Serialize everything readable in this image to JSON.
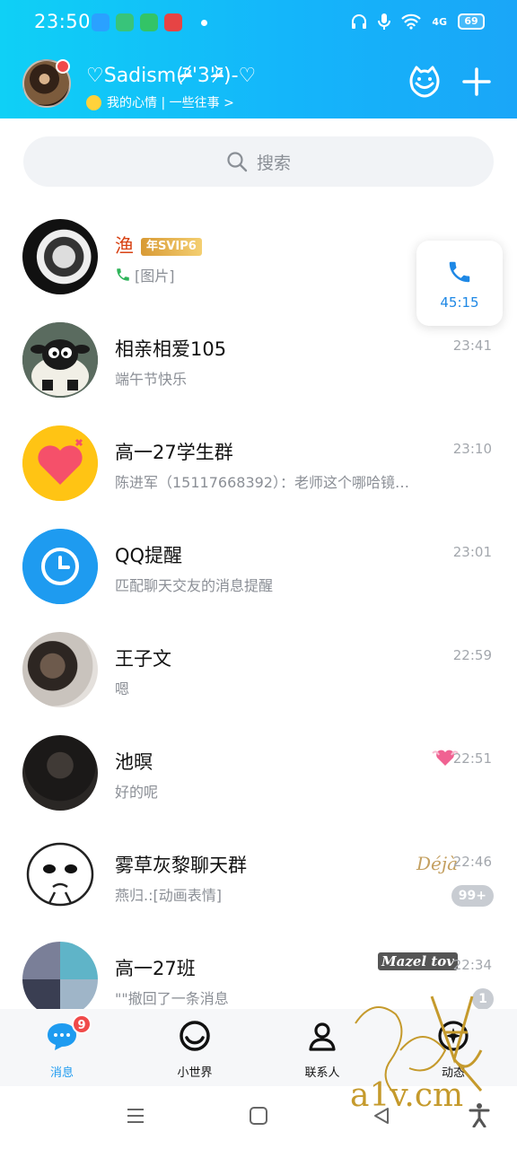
{
  "status_bar": {
    "time": "23:50",
    "network": "4G",
    "battery": "69",
    "app_colors": [
      "#2aa1ff",
      "#38c47a",
      "#33c466",
      "#e64444"
    ]
  },
  "header": {
    "nickname": "♡Sadism(ᵒ̴̶̷᷄'3'ᵒ̴̶̷᷅)-♡",
    "signature": "我的心情 | 一些往事 >",
    "accent": "#14b6fa"
  },
  "search": {
    "placeholder": "搜索"
  },
  "call_card": {
    "duration": "45:15"
  },
  "chats": [
    {
      "name": "渔",
      "vip": "年SVIP6",
      "message": "[图片]",
      "time": "",
      "unread": ""
    },
    {
      "name": "相亲相爱105",
      "message": "端午节快乐",
      "time": "23:41",
      "unread": ""
    },
    {
      "name": "高一27学生群",
      "message": "陈进军（15117668392）：老师这个哪哈镜…",
      "time": "23:10",
      "unread": ""
    },
    {
      "name": "QQ提醒",
      "message": "匹配聊天交友的消息提醒",
      "time": "23:01",
      "unread": ""
    },
    {
      "name": "王子文",
      "message": "嗯",
      "time": "22:59",
      "unread": ""
    },
    {
      "name": "池暝",
      "message": "好的呢",
      "time": "22:51",
      "unread": ""
    },
    {
      "name": "雾草灰黎聊天群",
      "message": "燕归.:[动画表情]",
      "time": "22:46",
      "tag": "Déjà",
      "unread": "99+"
    },
    {
      "name": "高一27班",
      "message": "\"\"撤回了一条消息",
      "time": "22:34",
      "tag": "Mazel tov",
      "unread": "1"
    }
  ],
  "tabs": [
    {
      "label": "消息",
      "badge": "9",
      "active": true
    },
    {
      "label": "小世界"
    },
    {
      "label": "联系人"
    },
    {
      "label": "动态"
    }
  ],
  "watermark": "a1v.cm"
}
